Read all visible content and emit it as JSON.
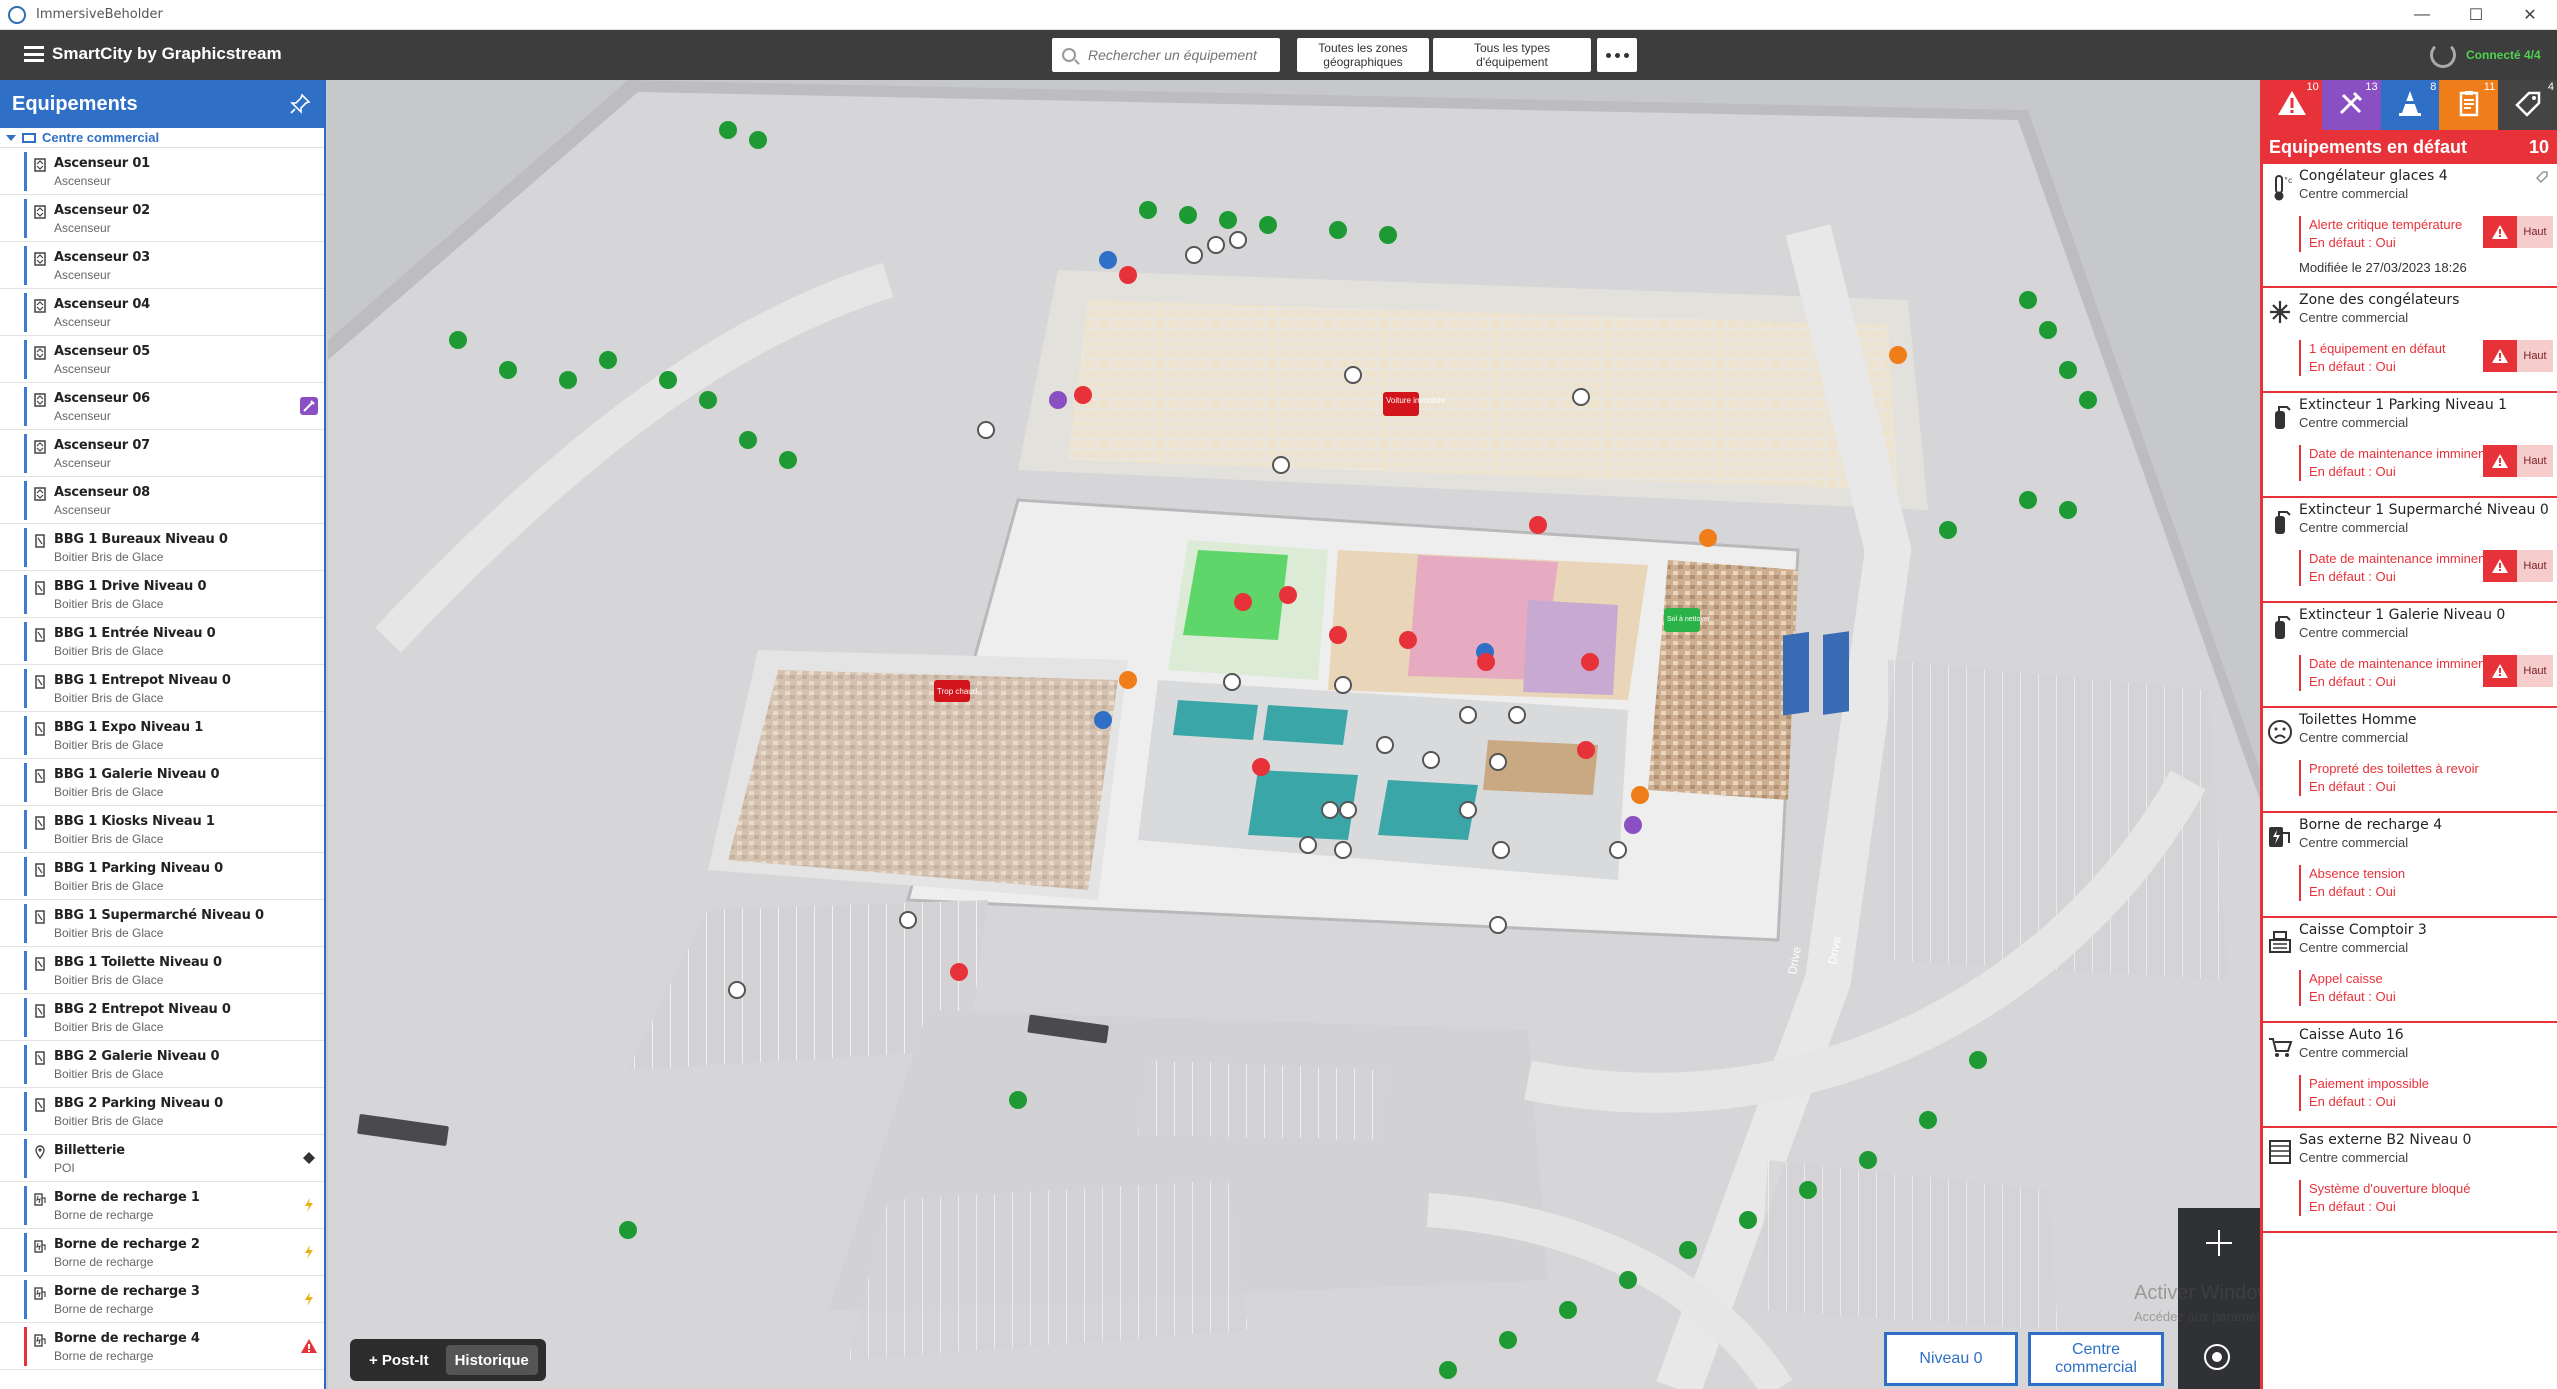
{
  "window": {
    "title": "ImmersiveBeholder",
    "minimize": "—",
    "maximize": "☐",
    "close": "✕"
  },
  "header": {
    "brand": "SmartCity by Graphicstream",
    "search_placeholder": "Rechercher un équipement",
    "zones_label_1": "Toutes les zones",
    "zones_label_2": "géographiques",
    "types_label_1": "Tous les types",
    "types_label_2": "d'équipement",
    "connection": "Connecté  4/4"
  },
  "sidebar": {
    "title": "Equipements",
    "group": "Centre commercial",
    "items": [
      {
        "name": "Ascenseur 01",
        "sub": "Ascenseur",
        "icon": "elevator",
        "right": ""
      },
      {
        "name": "Ascenseur 02",
        "sub": "Ascenseur",
        "icon": "elevator",
        "right": ""
      },
      {
        "name": "Ascenseur 03",
        "sub": "Ascenseur",
        "icon": "elevator",
        "right": ""
      },
      {
        "name": "Ascenseur 04",
        "sub": "Ascenseur",
        "icon": "elevator",
        "right": ""
      },
      {
        "name": "Ascenseur 05",
        "sub": "Ascenseur",
        "icon": "elevator",
        "right": ""
      },
      {
        "name": "Ascenseur 06",
        "sub": "Ascenseur",
        "icon": "elevator",
        "right": "tool"
      },
      {
        "name": "Ascenseur 07",
        "sub": "Ascenseur",
        "icon": "elevator",
        "right": ""
      },
      {
        "name": "Ascenseur 08",
        "sub": "Ascenseur",
        "icon": "elevator",
        "right": ""
      },
      {
        "name": "BBG 1 Bureaux Niveau 0",
        "sub": "Boitier Bris de Glace",
        "icon": "glass",
        "right": ""
      },
      {
        "name": "BBG 1 Drive Niveau 0",
        "sub": "Boitier Bris de Glace",
        "icon": "glass",
        "right": ""
      },
      {
        "name": "BBG 1 Entrée Niveau 0",
        "sub": "Boitier Bris de Glace",
        "icon": "glass",
        "right": ""
      },
      {
        "name": "BBG 1 Entrepot Niveau 0",
        "sub": "Boitier Bris de Glace",
        "icon": "glass",
        "right": ""
      },
      {
        "name": "BBG 1 Expo Niveau 1",
        "sub": "Boitier Bris de Glace",
        "icon": "glass",
        "right": ""
      },
      {
        "name": "BBG 1 Galerie Niveau 0",
        "sub": "Boitier Bris de Glace",
        "icon": "glass",
        "right": ""
      },
      {
        "name": "BBG 1 Kiosks Niveau 1",
        "sub": "Boitier Bris de Glace",
        "icon": "glass",
        "right": ""
      },
      {
        "name": "BBG 1 Parking Niveau 0",
        "sub": "Boitier Bris de Glace",
        "icon": "glass",
        "right": ""
      },
      {
        "name": "BBG 1 Supermarché Niveau 0",
        "sub": "Boitier Bris de Glace",
        "icon": "glass",
        "right": ""
      },
      {
        "name": "BBG 1 Toilette Niveau 0",
        "sub": "Boitier Bris de Glace",
        "icon": "glass",
        "right": ""
      },
      {
        "name": "BBG 2 Entrepot Niveau 0",
        "sub": "Boitier Bris de Glace",
        "icon": "glass",
        "right": ""
      },
      {
        "name": "BBG 2 Galerie Niveau 0",
        "sub": "Boitier Bris de Glace",
        "icon": "glass",
        "right": ""
      },
      {
        "name": "BBG 2 Parking Niveau 0",
        "sub": "Boitier Bris de Glace",
        "icon": "glass",
        "right": ""
      },
      {
        "name": "Billetterie",
        "sub": "POI",
        "icon": "poi",
        "right": "ticket"
      },
      {
        "name": "Borne de recharge 1",
        "sub": "Borne de recharge",
        "icon": "charger",
        "right": "bolt"
      },
      {
        "name": "Borne de recharge 2",
        "sub": "Borne de recharge",
        "icon": "charger",
        "right": "bolt"
      },
      {
        "name": "Borne de recharge 3",
        "sub": "Borne de recharge",
        "icon": "charger",
        "right": "bolt"
      },
      {
        "name": "Borne de recharge 4",
        "sub": "Borne de recharge",
        "icon": "charger",
        "right": "alert",
        "alarm": true
      }
    ]
  },
  "map": {
    "labels": {
      "voiture": "Voiture immobile",
      "trop_chaud": "Trop chaud",
      "drive1": "Drive",
      "drive2": "Drive",
      "green_note": "Sol à nettoyer"
    }
  },
  "toolbar": {
    "postit": "+ Post-It",
    "historique": "Historique"
  },
  "levels": {
    "niveau": "Niveau 0",
    "zone_1": "Centre",
    "zone_2": "commercial"
  },
  "watermark": {
    "line1": "Activer Windows",
    "line2": "Accédez aux paramètres pour activer Windows."
  },
  "right_panel": {
    "tabs": [
      {
        "icon": "warning-icon",
        "count": "10",
        "color": "#e8323a"
      },
      {
        "icon": "tools-icon",
        "count": "13",
        "color": "#8a4fc2"
      },
      {
        "icon": "cone-icon",
        "count": "8",
        "color": "#2f6fc6"
      },
      {
        "icon": "clipboard-icon",
        "count": "11",
        "color": "#ef7d1a"
      },
      {
        "icon": "tag-icon",
        "count": "4",
        "color": "#444444"
      }
    ],
    "title": "Equipements en défaut",
    "count": "10",
    "alerts": [
      {
        "name": "Congélateur glaces 4",
        "loc": "Centre commercial",
        "msg": "Alerte critique température",
        "def": "En défaut : Oui",
        "mod": "Modifiée le 27/03/2023 18:26",
        "haut": "Haut",
        "icon": "thermo"
      },
      {
        "name": "Zone des congélateurs",
        "loc": "Centre commercial",
        "msg": "1 équipement en défaut",
        "def": "En défaut : Oui",
        "mod": "",
        "haut": "Haut",
        "icon": "snow"
      },
      {
        "name": "Extincteur 1 Parking Niveau 1",
        "loc": "Centre commercial",
        "msg": "Date de maintenance imminente",
        "def": "En défaut : Oui",
        "mod": "",
        "haut": "Haut",
        "icon": "ext"
      },
      {
        "name": "Extincteur 1 Supermarché Niveau 0",
        "loc": "Centre commercial",
        "msg": "Date de maintenance imminente",
        "def": "En défaut : Oui",
        "mod": "",
        "haut": "Haut",
        "icon": "ext"
      },
      {
        "name": "Extincteur 1 Galerie Niveau 0",
        "loc": "Centre commercial",
        "msg": "Date de maintenance imminente",
        "def": "En défaut : Oui",
        "mod": "",
        "haut": "Haut",
        "icon": "ext"
      },
      {
        "name": "Toilettes Homme",
        "loc": "Centre commercial",
        "msg": "Propreté des toilettes à revoir",
        "def": "En défaut : Oui",
        "mod": "",
        "haut": "",
        "icon": "sad"
      },
      {
        "name": "Borne de recharge 4",
        "loc": "Centre commercial",
        "msg": "Absence tension",
        "def": "En défaut : Oui",
        "mod": "",
        "haut": "",
        "icon": "charger"
      },
      {
        "name": "Caisse Comptoir 3",
        "loc": "Centre commercial",
        "msg": "Appel caisse",
        "def": "En défaut : Oui",
        "mod": "",
        "haut": "",
        "icon": "register"
      },
      {
        "name": "Caisse Auto 16",
        "loc": "Centre commercial",
        "msg": "Paiement impossible",
        "def": "En défaut : Oui",
        "mod": "",
        "haut": "",
        "icon": "cart"
      },
      {
        "name": "Sas externe B2 Niveau 0",
        "loc": "Centre commercial",
        "msg": "Système d'ouverture bloqué",
        "def": "En défaut : Oui",
        "mod": "",
        "haut": "",
        "icon": "door"
      }
    ]
  }
}
